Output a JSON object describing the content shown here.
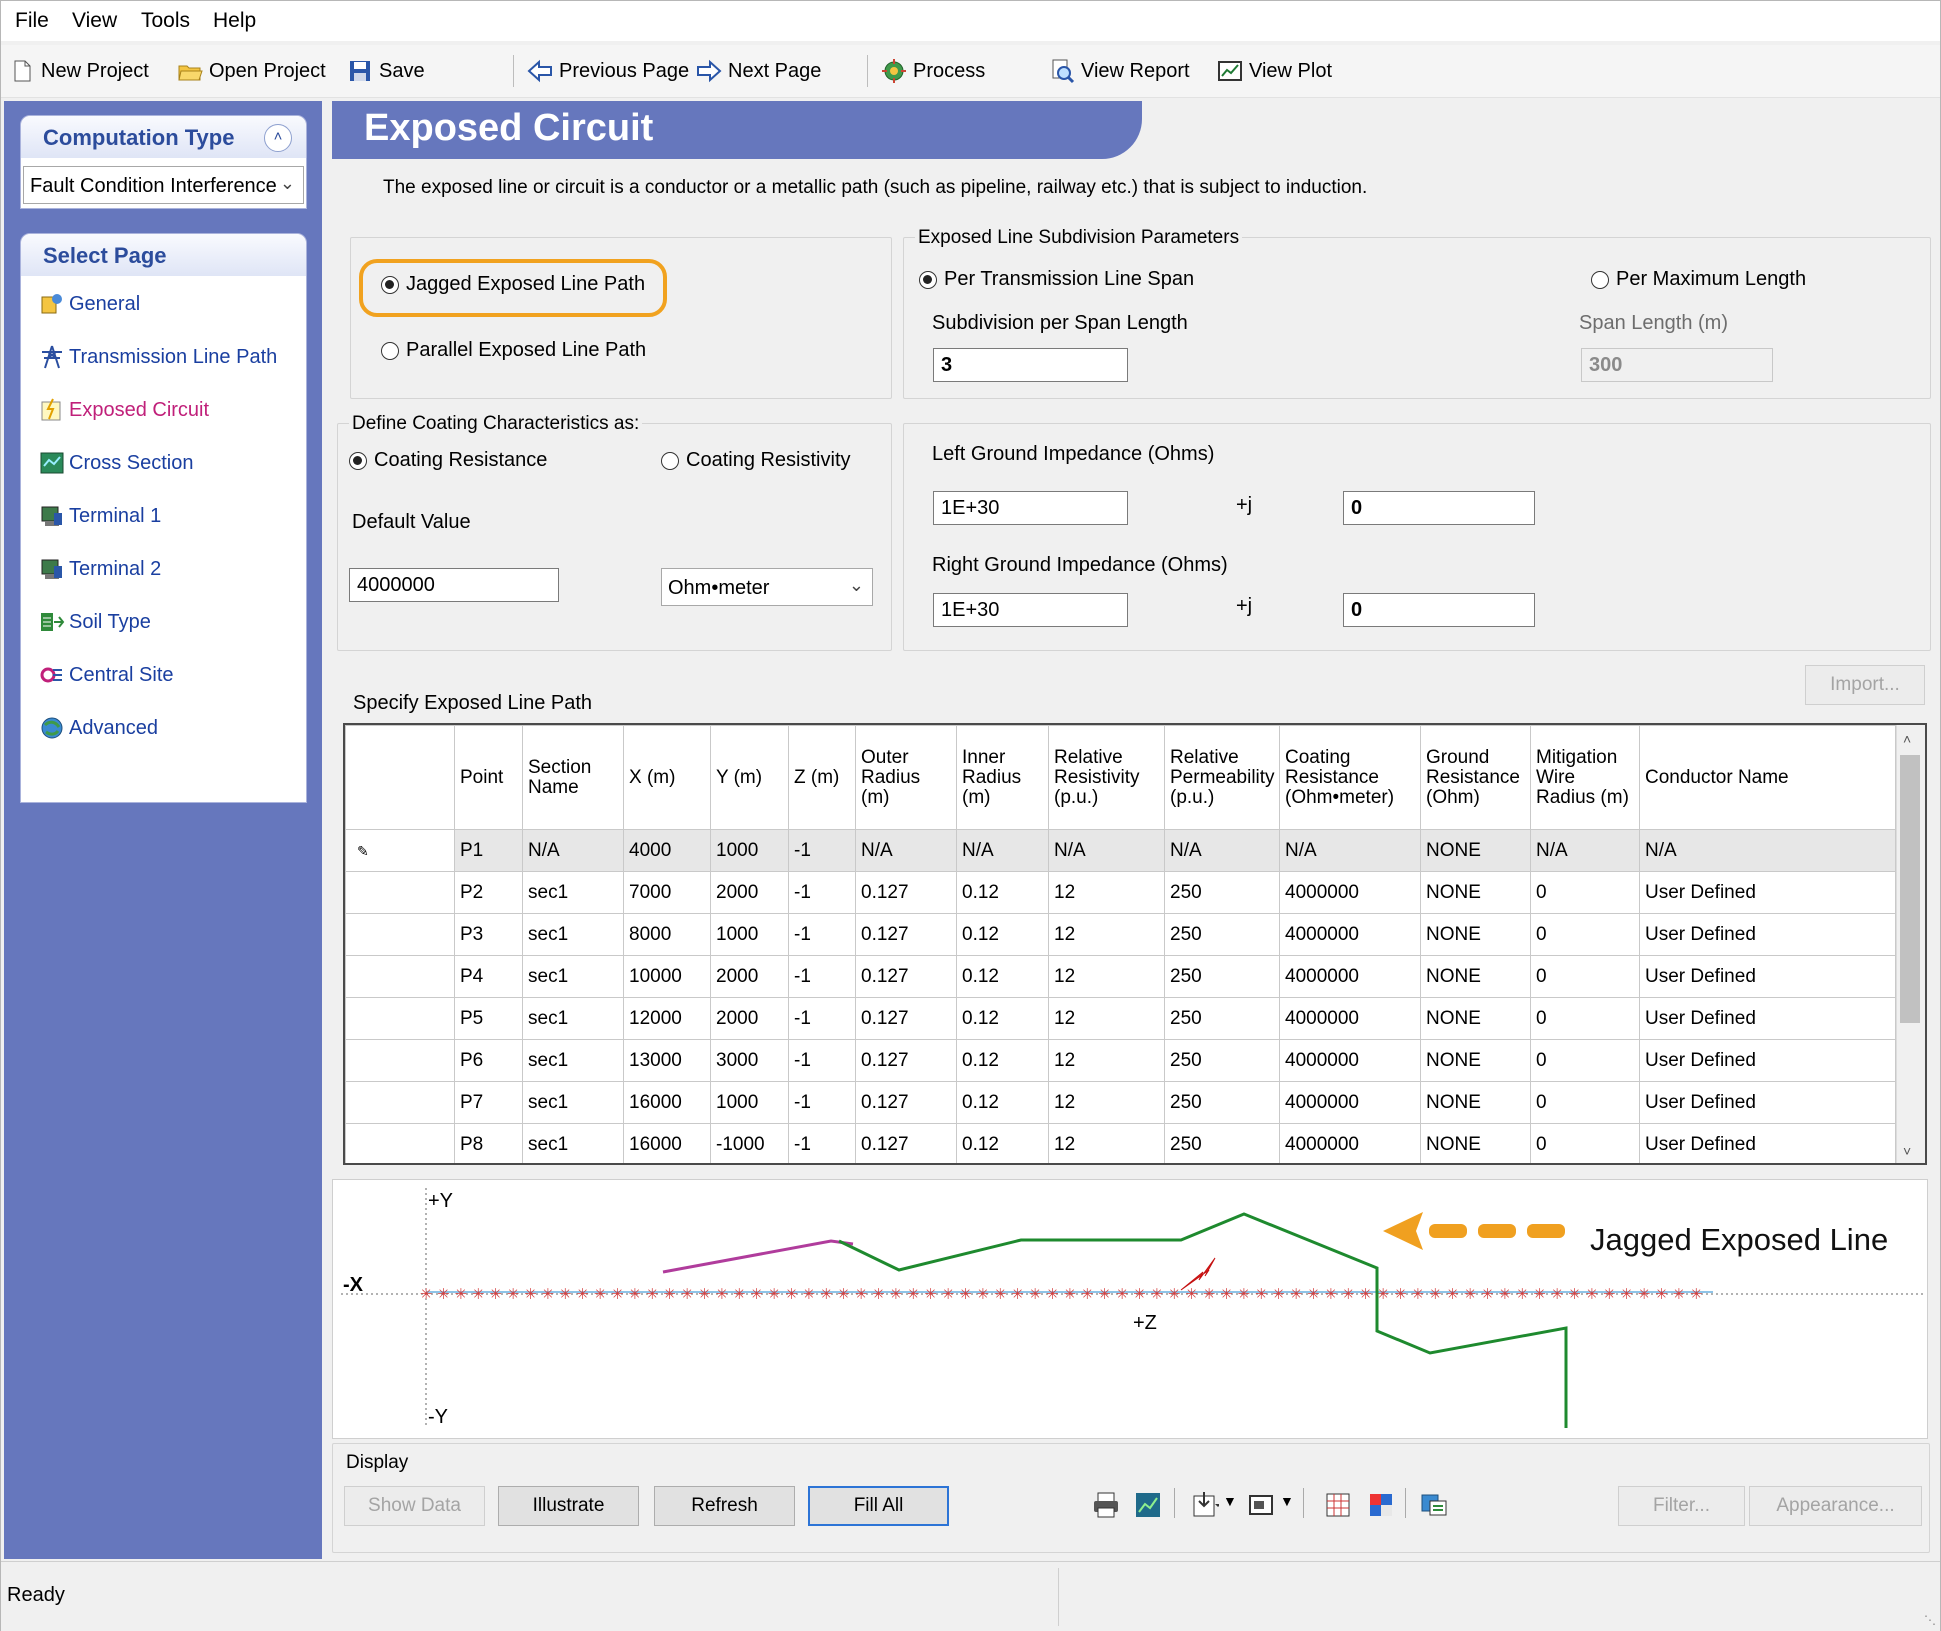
{
  "menu": [
    "File",
    "View",
    "Tools",
    "Help"
  ],
  "toolbar": {
    "new_project": "New Project",
    "open_project": "Open Project",
    "save": "Save",
    "previous_page": "Previous Page",
    "next_page": "Next Page",
    "process": "Process",
    "view_report": "View Report",
    "view_plot": "View Plot"
  },
  "sidebar": {
    "computation_type": {
      "title": "Computation Type",
      "value": "Fault Condition Interference"
    },
    "select_page": {
      "title": "Select Page",
      "items": [
        {
          "label": "General",
          "icon": "general-icon"
        },
        {
          "label": "Transmission Line Path",
          "icon": "tower-icon"
        },
        {
          "label": "Exposed Circuit",
          "icon": "exposed-circuit-icon",
          "active": true
        },
        {
          "label": "Cross Section",
          "icon": "cross-section-icon"
        },
        {
          "label": "Terminal 1",
          "icon": "terminal-icon"
        },
        {
          "label": "Terminal 2",
          "icon": "terminal-icon"
        },
        {
          "label": "Soil Type",
          "icon": "soil-icon"
        },
        {
          "label": "Central Site",
          "icon": "central-site-icon"
        },
        {
          "label": "Advanced",
          "icon": "advanced-icon"
        }
      ]
    }
  },
  "page": {
    "title": "Exposed Circuit",
    "description": "The exposed line or circuit is a conductor or a metallic path (such as pipeline, railway etc.) that is subject to induction."
  },
  "path_type": {
    "jagged": "Jagged Exposed Line Path",
    "parallel": "Parallel Exposed Line Path",
    "selected": "jagged"
  },
  "subdivision": {
    "title": "Exposed Line Subdivision Parameters",
    "per_span": "Per Transmission Line Span",
    "per_max": "Per Maximum Length",
    "subdivision_label": "Subdivision per Span Length",
    "subdivision_value": "3",
    "span_label": "Span Length (m)",
    "span_value": "300"
  },
  "coating": {
    "title": "Define Coating Characteristics as:",
    "resistance": "Coating Resistance",
    "resistivity": "Coating Resistivity",
    "default_label": "Default Value",
    "default_value": "4000000",
    "unit": "Ohm•meter"
  },
  "impedance": {
    "left_label": "Left Ground Impedance  (Ohms)",
    "left_real": "1E+30",
    "left_imag": "0",
    "right_label": "Right Ground Impedance  (Ohms)",
    "right_real": "1E+30",
    "right_imag": "0",
    "j": "+j"
  },
  "path_table": {
    "title": "Specify Exposed Line Path",
    "import": "Import...",
    "columns": [
      "",
      "Point",
      "Section Name",
      "X (m)",
      "Y  (m)",
      "Z (m)",
      "Outer Radius (m)",
      "Inner Radius (m)",
      "Relative Resistivity (p.u.)",
      "Relative Permeability (p.u.)",
      "Coating Resistance (Ohm•meter)",
      "Ground Resistance (Ohm)",
      "Mitigation Wire Radius (m)",
      "Conductor Name"
    ],
    "rows": [
      [
        "P1",
        "N/A",
        "4000",
        "1000",
        "-1",
        "N/A",
        "N/A",
        "N/A",
        "N/A",
        "N/A",
        "NONE",
        "N/A",
        "N/A"
      ],
      [
        "P2",
        "sec1",
        "7000",
        "2000",
        "-1",
        "0.127",
        "0.12",
        "12",
        "250",
        "4000000",
        "NONE",
        "0",
        "User Defined"
      ],
      [
        "P3",
        "sec1",
        "8000",
        "1000",
        "-1",
        "0.127",
        "0.12",
        "12",
        "250",
        "4000000",
        "NONE",
        "0",
        "User Defined"
      ],
      [
        "P4",
        "sec1",
        "10000",
        "2000",
        "-1",
        "0.127",
        "0.12",
        "12",
        "250",
        "4000000",
        "NONE",
        "0",
        "User Defined"
      ],
      [
        "P5",
        "sec1",
        "12000",
        "2000",
        "-1",
        "0.127",
        "0.12",
        "12",
        "250",
        "4000000",
        "NONE",
        "0",
        "User Defined"
      ],
      [
        "P6",
        "sec1",
        "13000",
        "3000",
        "-1",
        "0.127",
        "0.12",
        "12",
        "250",
        "4000000",
        "NONE",
        "0",
        "User Defined"
      ],
      [
        "P7",
        "sec1",
        "16000",
        "1000",
        "-1",
        "0.127",
        "0.12",
        "12",
        "250",
        "4000000",
        "NONE",
        "0",
        "User Defined"
      ],
      [
        "P8",
        "sec1",
        "16000",
        "-1000",
        "-1",
        "0.127",
        "0.12",
        "12",
        "250",
        "4000000",
        "NONE",
        "0",
        "User Defined"
      ]
    ]
  },
  "plot": {
    "plus_y": "+Y",
    "minus_y": "-Y",
    "minus_x": "-X",
    "plus_z": "+Z",
    "callout": "Jagged Exposed Line",
    "colors": {
      "exposed_line": "#1e8a2e",
      "magenta_line": "#b03c9c",
      "tower_line": "#d23b3b",
      "callout": "#f0a020"
    }
  },
  "display": {
    "title": "Display",
    "show_data": "Show Data",
    "illustrate": "Illustrate",
    "refresh": "Refresh",
    "fill_all": "Fill All",
    "filter": "Filter...",
    "appearance": "Appearance...",
    "icons": [
      "print-icon",
      "chart-icon",
      "export-icon",
      "window-icon",
      "grid-icon",
      "color-icon",
      "copy-icon"
    ]
  },
  "status": "Ready"
}
